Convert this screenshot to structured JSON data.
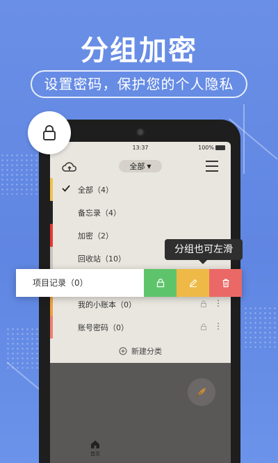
{
  "headline": "分组加密",
  "subtitle": "设置密码，保护您的个人隐私",
  "status": {
    "time": "13:37",
    "battery": "100%"
  },
  "topbar": {
    "category_select": "全部"
  },
  "categories": [
    {
      "label": "全部（4）",
      "color": "#f2c14e",
      "checked": true
    },
    {
      "label": "备忘录（4）",
      "color": "#222222"
    },
    {
      "label": "加密（2）",
      "color": "#e53935"
    },
    {
      "label": "回收站（10）",
      "color": "#c9c5bd"
    },
    {
      "label": "",
      "color": "#e9e6df"
    },
    {
      "label": "我的小账本（0）",
      "color": "#f0a040",
      "locked": true
    },
    {
      "label": "账号密码（0）",
      "color": "#f08070",
      "locked": true
    }
  ],
  "new_category": "新建分类",
  "tooltip": "分组也可左滑",
  "swipe_row": {
    "label": "项目记录（0）"
  },
  "bottom_tab": {
    "home_label": "首页"
  },
  "colors": {
    "lock": "#5ec46b",
    "edit": "#efb947",
    "delete": "#ea6866"
  }
}
